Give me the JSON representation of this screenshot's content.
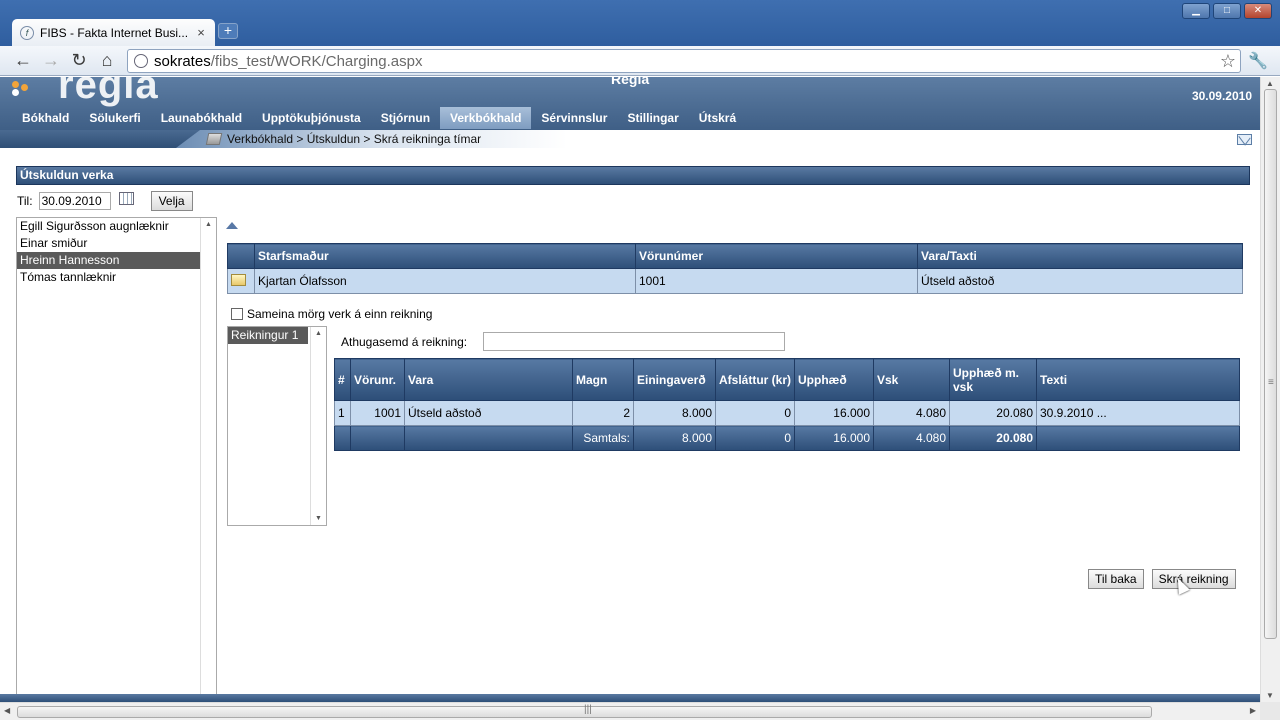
{
  "browser": {
    "tab_title": "FIBS - Fakta Internet Busi...",
    "tab_close": "×",
    "new_tab": "+",
    "url_host": "sokrates",
    "url_path": "/fibs_test/WORK/Charging.aspx",
    "win_min": "▁",
    "win_max": "□",
    "win_close": "✕"
  },
  "app": {
    "logo": "regla",
    "title": "Regla",
    "date": "30.09.2010",
    "menu": [
      "Bókhald",
      "Sölukerfi",
      "Launabókhald",
      "Upptökuþjónusta",
      "Stjórnun",
      "Verkbókhald",
      "Sérvinnslur",
      "Stillingar",
      "Útskrá"
    ],
    "active_menu_index": 5,
    "breadcrumb": "Verkbókhald > Útskuldun > Skrá reikninga tímar"
  },
  "section": {
    "title": "Útskuldun verka",
    "til_label": "Til:",
    "til_value": "30.09.2010",
    "velja_label": "Velja"
  },
  "employees": {
    "items": [
      "Egill Sigurðsson augnlæknir",
      "Einar smiður",
      "Hreinn Hannesson",
      "Tómas tannlæknir"
    ],
    "selected_index": 2
  },
  "job_table": {
    "columns": [
      "Starfsmaður",
      "Vörunúmer",
      "Vara/Taxti"
    ],
    "rows": [
      {
        "employee": "Kjartan Ólafsson",
        "product_no": "1001",
        "item": "Útseld aðstoð"
      }
    ]
  },
  "combine_label": "Sameina mörg verk á einn reikning",
  "invoices": [
    "Reikningur 1"
  ],
  "note_label": "Athugasemd á reikning:",
  "line_table": {
    "columns": [
      "#",
      "Vörunr.",
      "Vara",
      "Magn",
      "Einingaverð",
      "Afsláttur (kr)",
      "Upphæð",
      "Vsk",
      "Upphæð m. vsk",
      "Texti"
    ],
    "rows": [
      [
        "1",
        "1001",
        "Útseld aðstoð",
        "2",
        "8.000",
        "0",
        "16.000",
        "4.080",
        "20.080",
        "30.9.2010 ..."
      ]
    ],
    "total": [
      "",
      "",
      "",
      "Samtals:",
      "8.000",
      "0",
      "16.000",
      "4.080",
      "20.080",
      ""
    ]
  },
  "buttons": {
    "back": "Til baka",
    "register": "Skrá reikning"
  }
}
